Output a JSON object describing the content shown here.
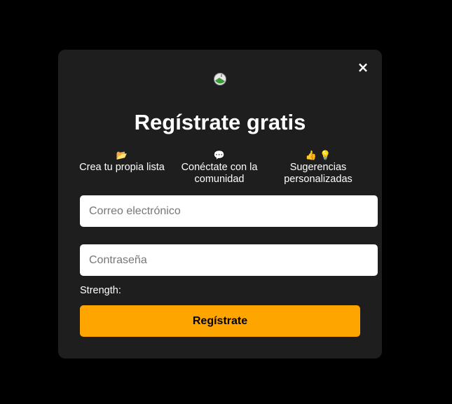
{
  "modal": {
    "close_label": "×",
    "title": "Regístrate gratis",
    "features": [
      {
        "icon": "folder-icon",
        "emoji": "📂",
        "label": "Crea tu propia lista"
      },
      {
        "icon": "speech-bubble-icon",
        "emoji": "💬",
        "label": "Conéctate con la comunidad"
      },
      {
        "icon": "thumbs-up-lightbulb-icon",
        "emoji": "👍 💡",
        "label": "Sugerencias personalizadas"
      }
    ],
    "email_placeholder": "Correo electrónico",
    "password_placeholder": "Contraseña",
    "strength_label": "Strength:",
    "submit_label": "Regístrate"
  },
  "colors": {
    "background": "#000000",
    "modal_bg": "#1e1e1e",
    "accent": "#ffa500"
  }
}
